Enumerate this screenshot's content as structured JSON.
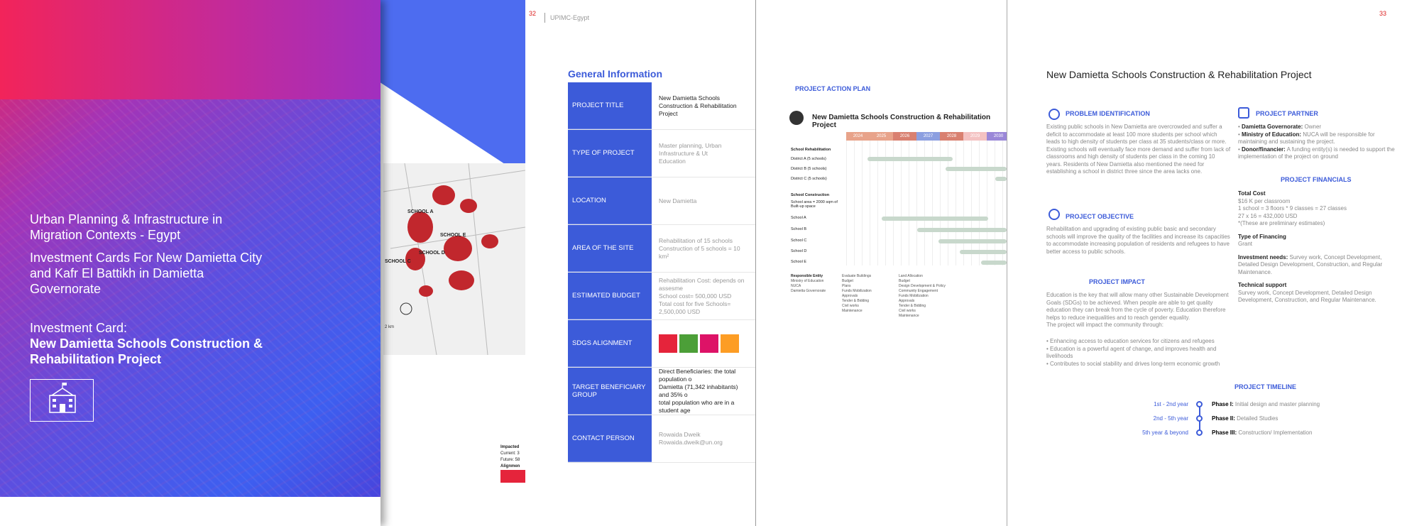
{
  "cover": {
    "title": "Urban Planning & Infrastructure in Migration Contexts - Egypt",
    "subtitle": "Investment Cards For New Damietta City and Kafr El Battikh in Damietta Governorate",
    "card_label": "Investment Card:",
    "card_name": "New Damietta Schools Construction & Rehabilitation Project",
    "icon": "school-building-icon"
  },
  "map": {
    "schools": [
      "SCHOOL A",
      "SCHOOL E",
      "SCHOOL D",
      "SCHOOL C"
    ],
    "scale": "2 km",
    "note": "Impacted",
    "current": "Current: 3",
    "future": "Future: 58",
    "alignment": "Alignmen"
  },
  "p32": {
    "page_number": "32",
    "header": "UPIMC-Egypt",
    "heading": "General Information",
    "rows": [
      {
        "label": "PROJECT TITLE",
        "value": "New Damietta Schools Construction & Rehabilitation Project"
      },
      {
        "label": "TYPE OF PROJECT",
        "value": "Master planning, Urban Infrastructure & Ut\nEducation"
      },
      {
        "label": "LOCATION",
        "value": "New Damietta"
      },
      {
        "label": "AREA OF THE SITE",
        "value": "Rehabilitation of 15 schools\nConstruction of 5 schools = 10 km²"
      },
      {
        "label": "ESTIMATED BUDGET",
        "value": "Rehabilitation Cost: depends on assesme\nSchool cost= 500,000 USD\nTotal cost for five Schools= 2,500,000 USD"
      },
      {
        "label": "SDGS ALIGNMENT",
        "value": ""
      },
      {
        "label": "TARGET BENEFICIARY GROUP",
        "value": "Direct Beneficiaries: the total population o\nDamietta (71,342 inhabitants) and 35% o\ntotal population who are in a student age"
      },
      {
        "label": "CONTACT PERSON",
        "value": "Rowaida Dweik\nRowaida.dweik@un.org"
      }
    ],
    "sdg_colors": [
      "#e5243b",
      "#4c9f38",
      "#dd1367",
      "#fd9d24"
    ]
  },
  "action_plan": {
    "title": "PROJECT ACTION PLAN",
    "project": "New Damietta Schools Construction & Rehabilitation Project",
    "years": [
      "2024",
      "2025",
      "2026",
      "2027",
      "2028",
      "2029",
      "2030",
      "20"
    ],
    "year_colors": [
      "#e8a38a",
      "#e8a38a",
      "#d98070",
      "#8c9fe0",
      "#d98070",
      "#f4c2c2",
      "#9a87d8",
      "#6a3a8a"
    ],
    "rehab_title": "School Rehabilitation",
    "rehab_rows": [
      "District A (5 schools)",
      "District B (5 schools)",
      "District C (5 schools)"
    ],
    "constr_title": "School Construction",
    "constr_note": "School area = 2000 sqm of Built-up space",
    "constr_rows": [
      "School A",
      "School B",
      "School C",
      "School D",
      "School E"
    ],
    "responsible_title": "Responsible Entity",
    "responsible": [
      "Ministry of Education",
      "NUCA",
      "Damietta Governorate"
    ],
    "legend": [
      "Evaluate Buildings",
      "Budget",
      "Plans",
      "Funds Mobilization",
      "Approvals",
      "Tender & Bidding",
      "Civil works",
      "Maintenance",
      "Land Allocation",
      "Budget",
      "Design Development & Policy",
      "Community Engagement",
      "Funds Mobilization",
      "Approvals",
      "Tender & Bidding",
      "Civil works",
      "Maintenance"
    ]
  },
  "p33": {
    "page_number": "33",
    "heading": "New Damietta Schools Construction & Rehabilitation Project",
    "problem_title": "PROBLEM IDENTIFICATION",
    "problem_text": "Existing public schools in New Damietta are overcrowded and suffer a deficit to accommodate at least 100 more students per school which leads to high density of students per class at 35 students/class or more. Existing schools will eventually face more demand and suffer from lack of classrooms and high density of students per class in the coming 10 years. Residents of New Damietta also mentioned the need for establishing a school in district three since the area lacks one.",
    "objective_title": "PROJECT OBJECTIVE",
    "objective_text": "Rehabilitation and upgrading of existing public basic and secondary schools will improve the quality of the facilities and increase its capacities to accommodate increasing population of residents and refugees to have better access to public schools.",
    "impact_title": "PROJECT IMPACT",
    "impact_text": "Education is the key that will allow many other Sustainable Development Goals (SDGs) to be achieved. When people are able to get quality education they can break from the cycle of poverty. Education therefore helps to reduce inequalities and to reach gender equality.\nThe project will impact the community through:",
    "impact_bullets": [
      "Enhancing access to education services for citizens and refugees",
      "Education is a powerful agent of change, and improves health and livelihoods",
      "Contributes to social stability and drives long-term economic growth"
    ],
    "partner_title": "PROJECT PARTNER",
    "partners": [
      {
        "name": "Damietta Governorate:",
        "desc": "Owner"
      },
      {
        "name": "Ministry of Education:",
        "desc": "NUCA will be responsible for maintaining and sustaining the project."
      },
      {
        "name": "Donor/financier:",
        "desc": "A funding entity(s) is needed to support the implementation of the project on ground"
      }
    ],
    "financials_title": "PROJECT FINANCIALS",
    "total_cost_label": "Total Cost",
    "total_cost_text": "$16 K per classroom\n1 school = 3 floors * 9 classes = 27 classes\n27 x 16 = 432,000 USD\n*(These are preliminary estimates)",
    "financing_label": "Type of Financing",
    "financing_text": "Grant",
    "investment_label": "Investment needs:",
    "investment_text": "Survey work, Concept Development, Detailed Design Development, Construction, and Regular Maintenance.",
    "support_label": "Technical support",
    "support_text": "Survey work, Concept Development, Detailed Design Development, Construction, and Regular Maintenance.",
    "timeline_title": "PROJECT TIMELINE",
    "timeline": [
      {
        "years": "1st - 2nd year",
        "phase": "Phase I:",
        "desc": "Initial design and master planning"
      },
      {
        "years": "2nd - 5th year",
        "phase": "Phase II:",
        "desc": "Detailed Studies"
      },
      {
        "years": "5th year & beyond",
        "phase": "Phase III:",
        "desc": "Construction/ Implementation"
      }
    ]
  }
}
